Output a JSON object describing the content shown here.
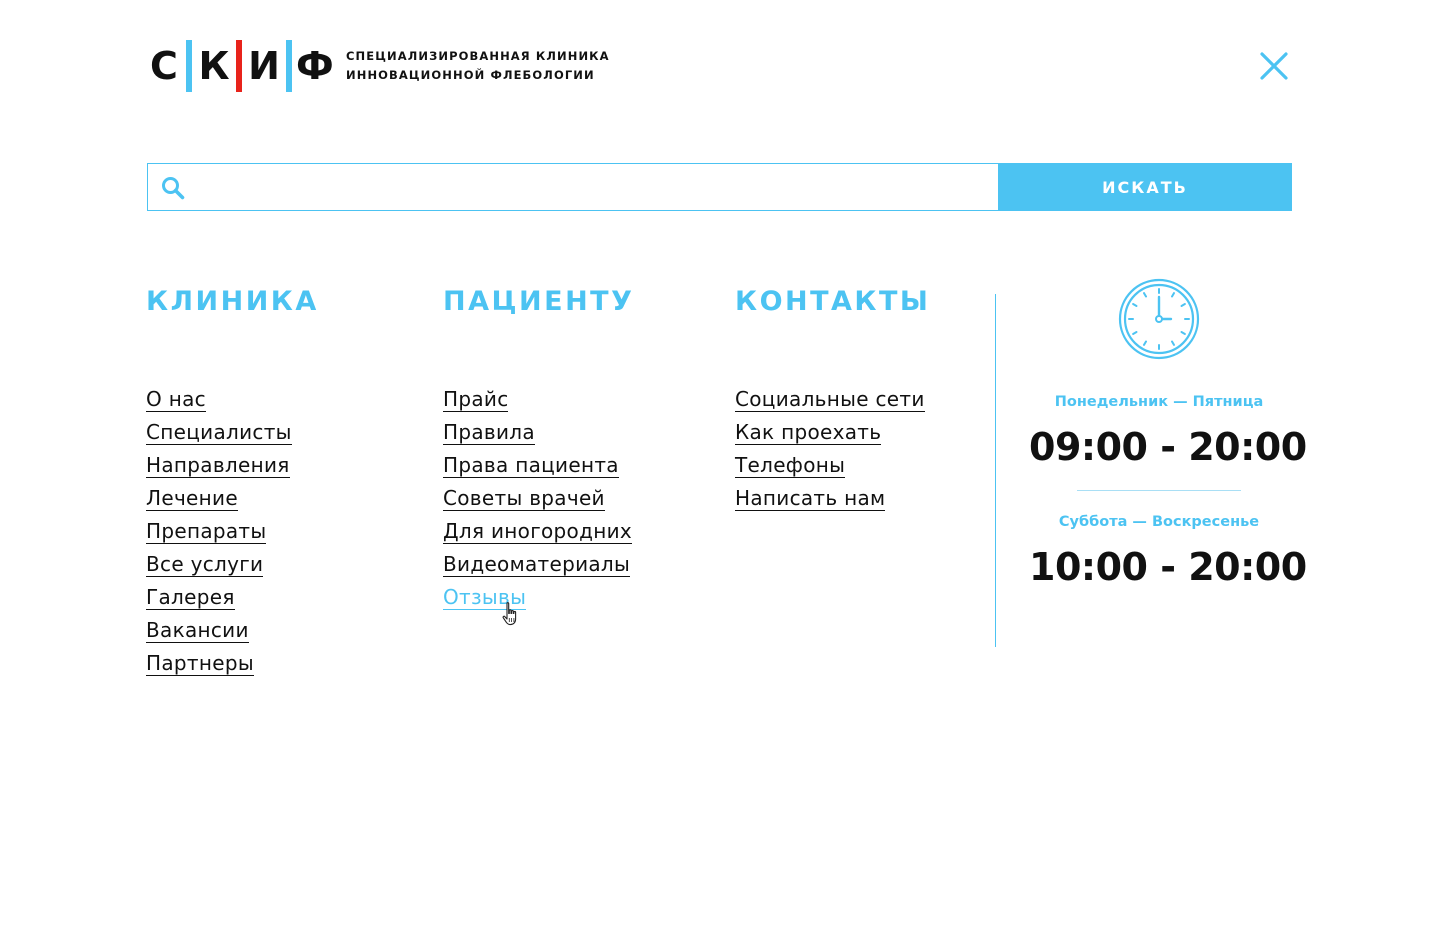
{
  "brand": {
    "letters": [
      "С",
      "К",
      "И",
      "Ф"
    ],
    "tagline_line1": "СПЕЦИАЛИЗИРОВАННАЯ КЛИНИКА",
    "tagline_line2": "ИННОВАЦИОННОЙ ФЛЕБОЛОГИИ",
    "accent_color": "#4cc3f2",
    "red_color": "#e8231b"
  },
  "close": {
    "icon": "close-icon"
  },
  "search": {
    "icon": "search-icon",
    "value": "",
    "placeholder": "",
    "button_label": "ИСКАТЬ"
  },
  "menu": {
    "clinic": {
      "title": "КЛИНИКА",
      "items": [
        {
          "label": "О нас"
        },
        {
          "label": "Специалисты"
        },
        {
          "label": "Направления"
        },
        {
          "label": "Лечение"
        },
        {
          "label": "Препараты"
        },
        {
          "label": "Все услуги"
        },
        {
          "label": "Галерея"
        },
        {
          "label": "Вакансии"
        },
        {
          "label": "Партнеры"
        }
      ]
    },
    "patient": {
      "title": "ПАЦИЕНТУ",
      "items": [
        {
          "label": "Прайс"
        },
        {
          "label": "Правила"
        },
        {
          "label": "Права пациента"
        },
        {
          "label": "Советы врачей"
        },
        {
          "label": "Для иногородних"
        },
        {
          "label": "Видеоматериалы"
        },
        {
          "label": "Отзывы",
          "state": "hover"
        }
      ]
    },
    "contacts": {
      "title": "КОНТАКТЫ",
      "items": [
        {
          "label": "Социальные сети"
        },
        {
          "label": "Как проехать"
        },
        {
          "label": "Телефоны"
        },
        {
          "label": "Написать нам"
        }
      ]
    }
  },
  "hours": {
    "icon": "clock-icon",
    "weekdays_label": "Понедельник — Пятница",
    "weekdays_time": "09:00 - 20:00",
    "weekend_label": "Суббота — Воскресенье",
    "weekend_time": "10:00 - 20:00"
  }
}
